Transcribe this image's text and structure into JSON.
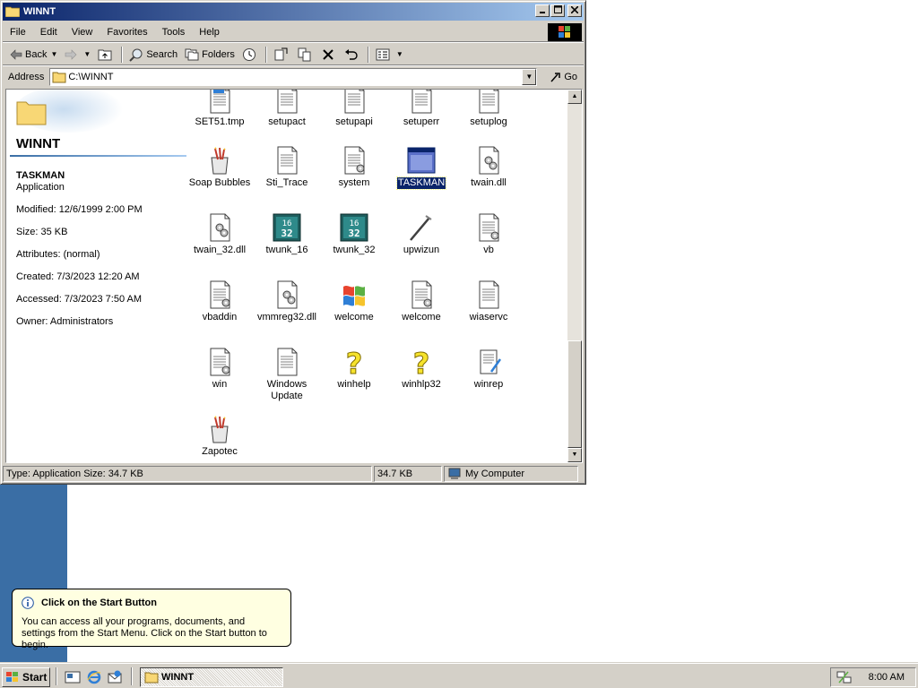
{
  "window": {
    "title": "WINNT",
    "menu": [
      "File",
      "Edit",
      "View",
      "Favorites",
      "Tools",
      "Help"
    ],
    "toolbar": {
      "back_label": "Back",
      "search_label": "Search",
      "folders_label": "Folders"
    },
    "address": {
      "label": "Address",
      "value": "C:\\WINNT",
      "go_label": "Go"
    }
  },
  "left_panel": {
    "folder_title": "WINNT",
    "item_name": "TASKMAN",
    "item_type": "Application",
    "modified": "Modified: 12/6/1999 2:00 PM",
    "size": "Size: 35 KB",
    "attributes": "Attributes: (normal)",
    "created": "Created: 7/3/2023 12:20 AM",
    "accessed": "Accessed: 7/3/2023 7:50 AM",
    "owner": "Owner: Administrators"
  },
  "files": [
    {
      "label": "SET51.tmp",
      "icon": "tmp-file-icon"
    },
    {
      "label": "setupact",
      "icon": "text-file-icon"
    },
    {
      "label": "setupapi",
      "icon": "text-file-icon"
    },
    {
      "label": "setuperr",
      "icon": "text-file-icon"
    },
    {
      "label": "setuplog",
      "icon": "text-file-icon"
    },
    {
      "label": "Soap Bubbles",
      "icon": "paint-bitmap-icon"
    },
    {
      "label": "Sti_Trace",
      "icon": "text-file-icon"
    },
    {
      "label": "system",
      "icon": "config-file-icon"
    },
    {
      "label": "TASKMAN",
      "icon": "application-window-icon",
      "selected": true
    },
    {
      "label": "twain.dll",
      "icon": "dll-file-icon"
    },
    {
      "label": "twain_32.dll",
      "icon": "dll-file-icon"
    },
    {
      "label": "twunk_16",
      "icon": "twunk-16-icon"
    },
    {
      "label": "twunk_32",
      "icon": "twunk-32-icon"
    },
    {
      "label": "upwizun",
      "icon": "wizard-wand-icon"
    },
    {
      "label": "vb",
      "icon": "config-file-icon"
    },
    {
      "label": "vbaddin",
      "icon": "config-file-icon"
    },
    {
      "label": "vmmreg32.dll",
      "icon": "dll-file-icon"
    },
    {
      "label": "welcome",
      "icon": "windows-flag-icon"
    },
    {
      "label": "welcome",
      "icon": "config-file-icon"
    },
    {
      "label": "wiaservc",
      "icon": "text-file-icon"
    },
    {
      "label": "win",
      "icon": "config-file-icon"
    },
    {
      "label": "Windows Update",
      "icon": "text-file-icon"
    },
    {
      "label": "winhelp",
      "icon": "help-question-icon"
    },
    {
      "label": "winhlp32",
      "icon": "help-question-icon"
    },
    {
      "label": "winrep",
      "icon": "report-scroll-icon"
    },
    {
      "label": "Zapotec",
      "icon": "paint-bitmap-icon"
    }
  ],
  "status": {
    "info": "Type: Application Size: 34.7 KB",
    "size": "34.7 KB",
    "zone": "My Computer"
  },
  "balloon": {
    "title": "Click on the Start Button",
    "text": "You can access all your programs, documents, and settings from the Start Menu. Click on the Start button to begin."
  },
  "taskbar": {
    "start_label": "Start",
    "task_label": "WINNT",
    "clock": "8:00 AM"
  },
  "colors": {
    "titlebar_start": "#0a246a",
    "titlebar_end": "#a6caf0",
    "face": "#d4d0c8",
    "selection": "#0a246a",
    "balloon_bg": "#ffffe1",
    "desktop": "#3a6ea5"
  }
}
